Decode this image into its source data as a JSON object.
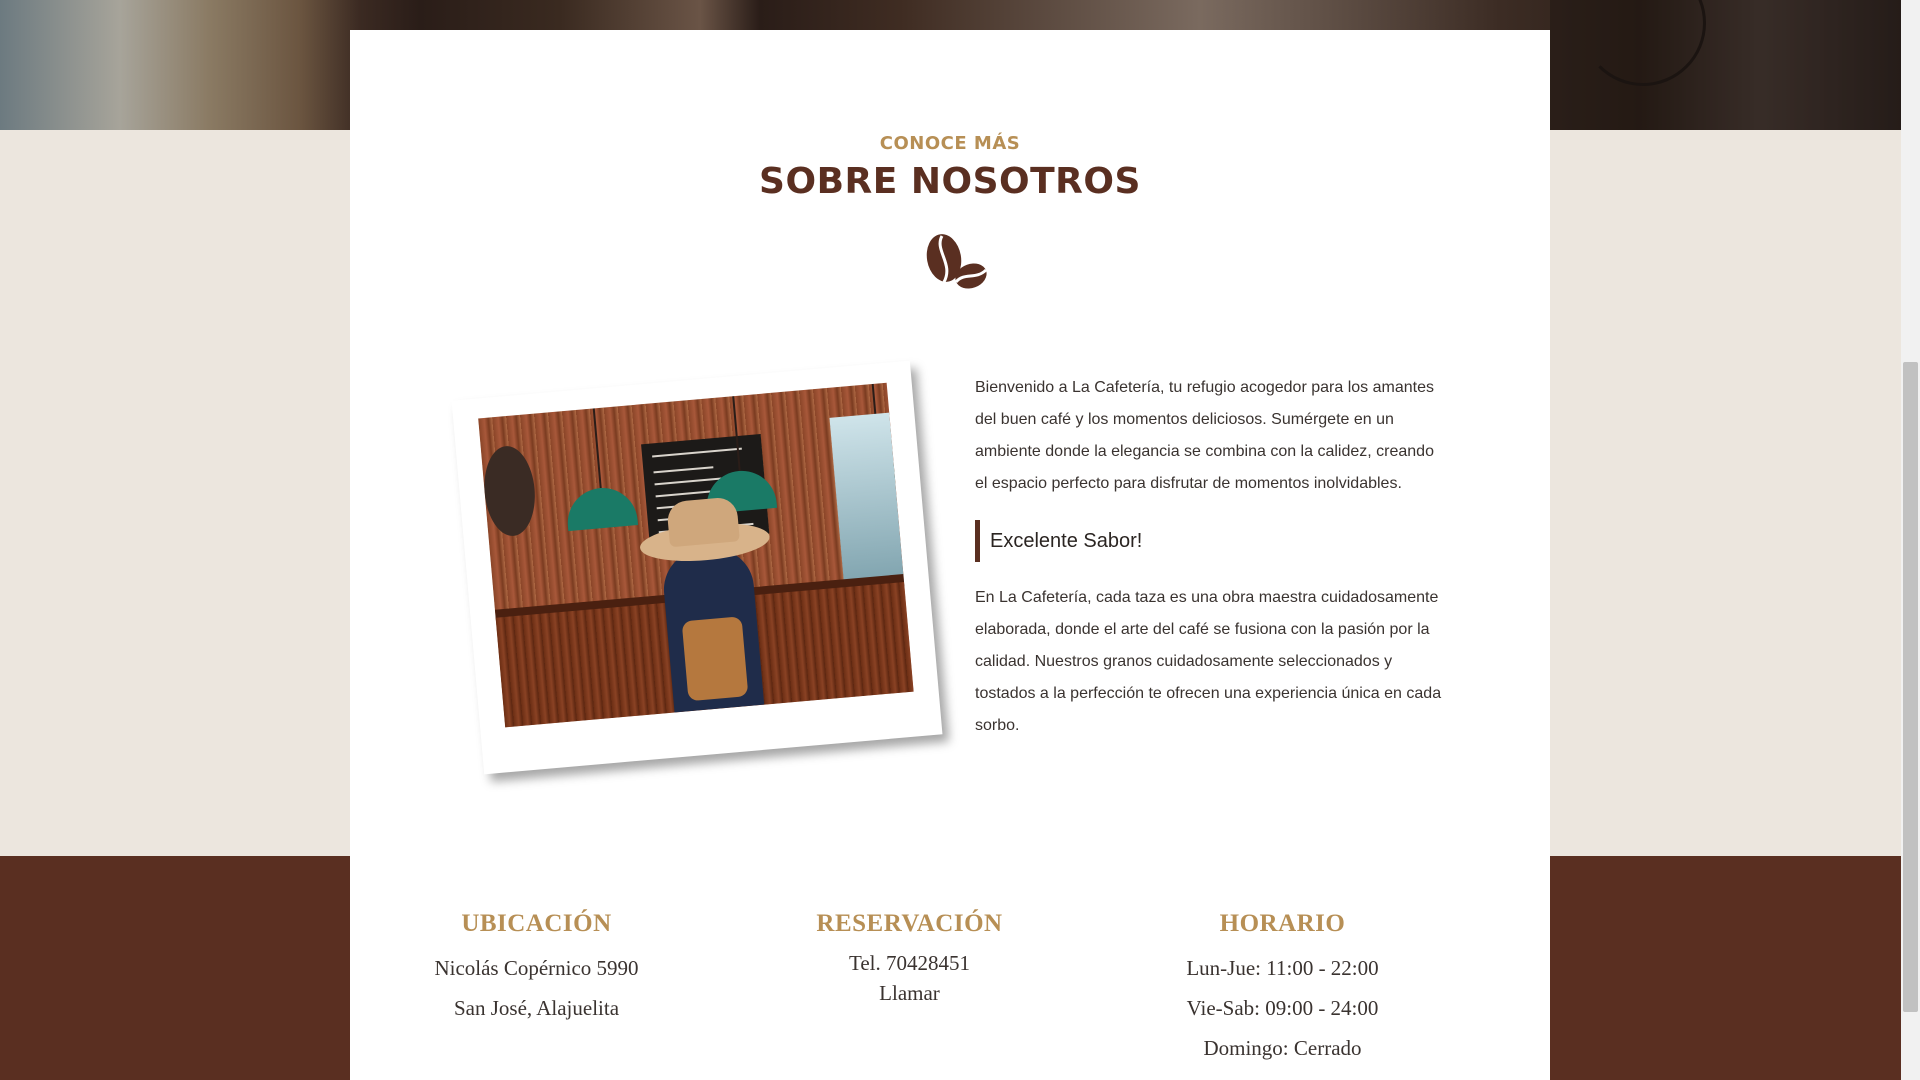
{
  "about": {
    "eyebrow": "CONOCE MÁS",
    "title": "SOBRE NOSOTROS",
    "icon": "coffee-beans-icon",
    "intro": "Bienvenido a La Cafetería, tu refugio acogedor para los amantes del buen café y los momentos deliciosos. Sumérgete en un ambiente donde la elegancia se combina con la calidez, creando el espacio perfecto para disfrutar de momentos inolvidables.",
    "subheading": "Excelente Sabor!",
    "body": "En La Cafetería, cada taza es una obra maestra cuidadosamente elaborada, donde el arte del café se fusiona con la pasión por la calidad. Nuestros granos cuidadosamente seleccionados y tostados a la perfección te ofrecen una experiencia única en cada sorbo."
  },
  "info": {
    "location": {
      "title": "UBICACIÓN",
      "lines": [
        "Nicolás Copérnico 5990",
        "San José, Alajuelita"
      ]
    },
    "reservation": {
      "title": "RESERVACIÓN",
      "phone": "Tel. 70428451",
      "call_label": "Llamar"
    },
    "hours": {
      "title": "HORARIO",
      "lines": [
        "Lun-Jue: 11:00 - 22:00",
        "Vie-Sab: 09:00 - 24:00",
        "Domingo: Cerrado"
      ]
    }
  },
  "colors": {
    "brand_brown": "#5a2f21",
    "accent_gold": "#b78f55",
    "background": "#ece6de"
  }
}
